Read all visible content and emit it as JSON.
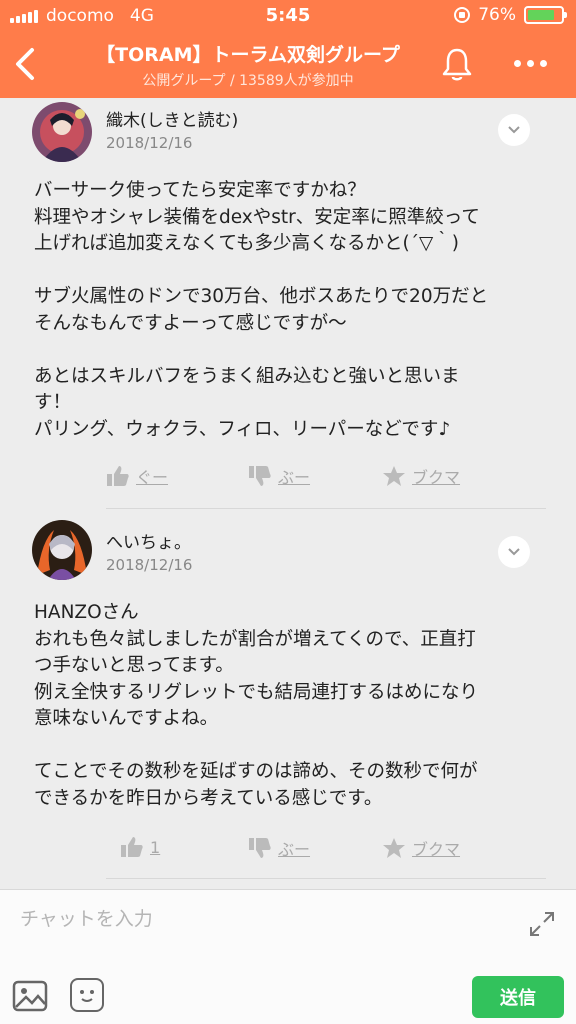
{
  "status_bar": {
    "carrier": "docomo",
    "network": "4G",
    "time": "5:45",
    "battery": "76%",
    "battery_level": 0.76
  },
  "header": {
    "title": "【TORAM】トーラム双剣グループ",
    "subtitle": "公開グループ / 13589人が参加中"
  },
  "posts": [
    {
      "author": "織木(しきと読む)",
      "date": "2018/12/16",
      "lines": [
        "バーサーク使ってたら安定率ですかね？",
        "料理やオシャレ装備をdexやstr、安定率に照準絞って",
        "上げれば追加変えなくても多少高くなるかと(´▽｀)",
        "",
        "サブ火属性のドンで30万台、他ボスあたりで20万だと",
        "そんなもんですよーって感じですが〜",
        "",
        "あとはスキルバフをうまく組み込むと強いと思いま",
        "す！",
        "パリング、ウォクラ、フィロ、リーパーなどです♪"
      ],
      "actions": {
        "good": "ぐー",
        "bad": "ぶー",
        "bookmark": "ブクマ"
      }
    },
    {
      "author": "へいちょ。",
      "date": "2018/12/16",
      "lines": [
        "HANZOさん",
        "おれも色々試しましたが割合が増えてくので、正直打",
        "つ手ないと思ってます。",
        "例え全快するリグレットでも結局連打するはめになり",
        "意味ないんですよね。",
        "",
        "てことでその数秒を延ばすのは諦め、その数秒で何が",
        "できるかを昨日から考えている感じです。"
      ],
      "actions": {
        "good": "1",
        "bad": "ぶー",
        "bookmark": "ブクマ"
      }
    }
  ],
  "input": {
    "placeholder": "チャットを入力",
    "send_label": "送信"
  },
  "colors": {
    "header": "#ff7c4a",
    "send": "#32c25c",
    "battery_fill": "#63d35a"
  }
}
